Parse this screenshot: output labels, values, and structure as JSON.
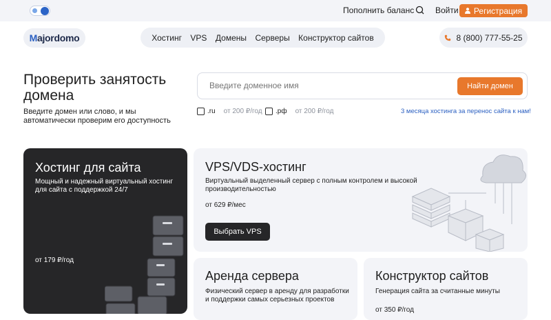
{
  "topbar": {
    "balance_link": "Пополнить баланс",
    "login": "Войти",
    "register": "Регистрация"
  },
  "brand": {
    "logo_m": "M",
    "logo_rest": "ajordomo"
  },
  "nav": [
    "Хостинг",
    "VPS",
    "Домены",
    "Серверы",
    "Конструктор сайтов"
  ],
  "phone": "8 (800) 777-55-25",
  "hero": {
    "title": "Проверить занятость домена",
    "subtitle": "Введите домен или слово, и мы автоматически проверим его доступность",
    "placeholder": "Введите доменное имя",
    "button": "Найти домен",
    "zones": [
      {
        "name": ".ru",
        "price": "от 200 ₽/год"
      },
      {
        "name": ".рф",
        "price": "от 200 ₽/год"
      }
    ],
    "promo": "3 месяца хостинга за перенос сайта к нам!"
  },
  "cards": {
    "hosting": {
      "title": "Хостинг для сайта",
      "desc": "Мощный и надежный виртуальный хостинг для сайта с поддержкой 24/7",
      "price": "от 179 ₽/год"
    },
    "vps": {
      "title": "VPS/VDS-хостинг",
      "desc": "Виртуальный выделенный сервер с полным контролем и высокой производительностью",
      "price": "от 629 ₽/мес",
      "button": "Выбрать VPS"
    },
    "server": {
      "title": "Аренда сервера",
      "desc": "Физический сервер в аренду для разработки и поддержки самых серьезных проектов"
    },
    "builder": {
      "title": "Конструктор сайтов",
      "desc": "Генерация сайта за считанные минуты",
      "price": "от 350 ₽/год"
    }
  },
  "colors": {
    "accent": "#e8782c",
    "link": "#2a5fc1",
    "dark_card": "#262628",
    "light_card": "#f3f4f8"
  }
}
